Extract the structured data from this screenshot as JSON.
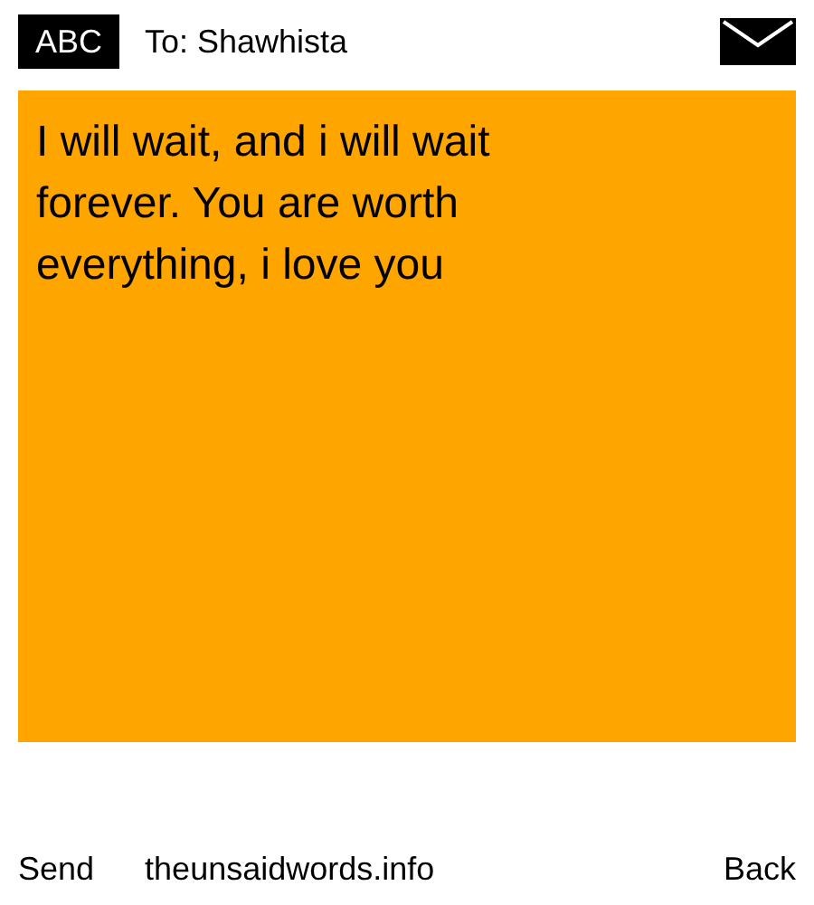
{
  "header": {
    "badge": "ABC",
    "recipient": "To: Shawhista"
  },
  "message": "I will wait, and i will wait forever. You are worth everything, i love you",
  "footer": {
    "send": "Send",
    "site": "theunsaidwords.info",
    "back": "Back"
  }
}
